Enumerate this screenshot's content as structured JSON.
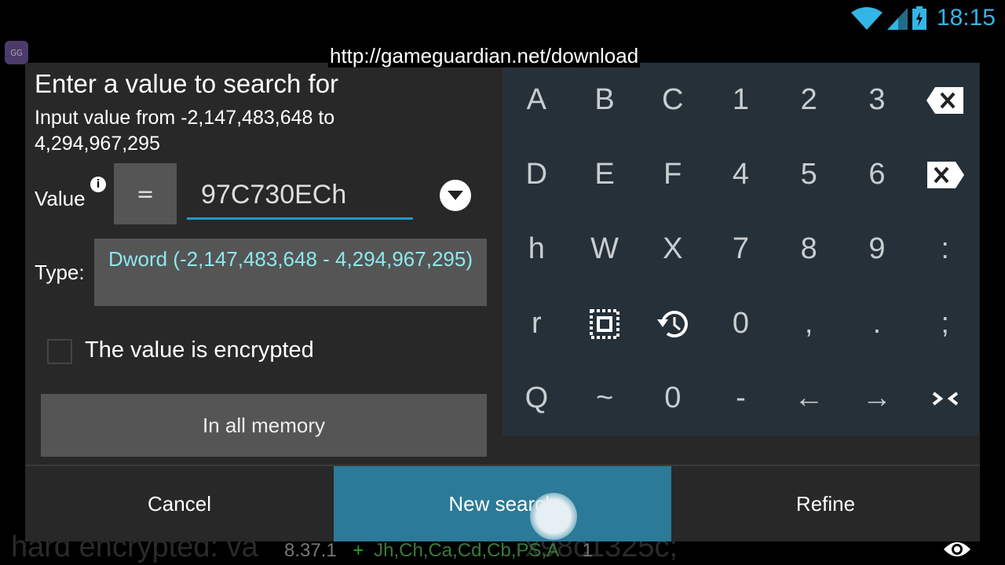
{
  "status_bar": {
    "time": "18:15",
    "icons": [
      "wifi-icon",
      "signal-icon",
      "battery-charging-icon"
    ],
    "accent": "#33b5e5"
  },
  "overlay_url": "http://gameguardian.net/download",
  "background_text": "hard encrypted: va",
  "background_text_tail": "x98c1325c;",
  "dialog": {
    "title": "Enter a value to search for",
    "range_text": "Input value from -2,147,483,648 to 4,294,967,295",
    "value_label": "Value",
    "operator": "=",
    "value": "97C730ECh",
    "type_label": "Type:",
    "type_value": "Dword (-2,147,483,648 - 4,294,967,295)",
    "encrypted_label": "The value is encrypted",
    "encrypted_checked": false,
    "memory_button": "In all memory",
    "buttons": {
      "cancel": "Cancel",
      "new_search": "New search",
      "refine": "Refine"
    },
    "accent": "#2b7a97"
  },
  "keyboard": {
    "keys": [
      "A",
      "B",
      "C",
      "1",
      "2",
      "3",
      "backspace-icon",
      "D",
      "E",
      "F",
      "4",
      "5",
      "6",
      "delete-icon",
      "h",
      "W",
      "X",
      "7",
      "8",
      "9",
      ":",
      "r",
      "select-all-icon",
      "history-icon",
      "0",
      ",",
      ".",
      ";",
      "Q",
      "~",
      "0",
      "-",
      "←",
      "→",
      "collapse-icon"
    ]
  },
  "footer": {
    "version": "8.37.1",
    "plus": "+",
    "flags": "Jh,Ch,Ca,Cd,Cb,PS,A",
    "count": "1"
  }
}
